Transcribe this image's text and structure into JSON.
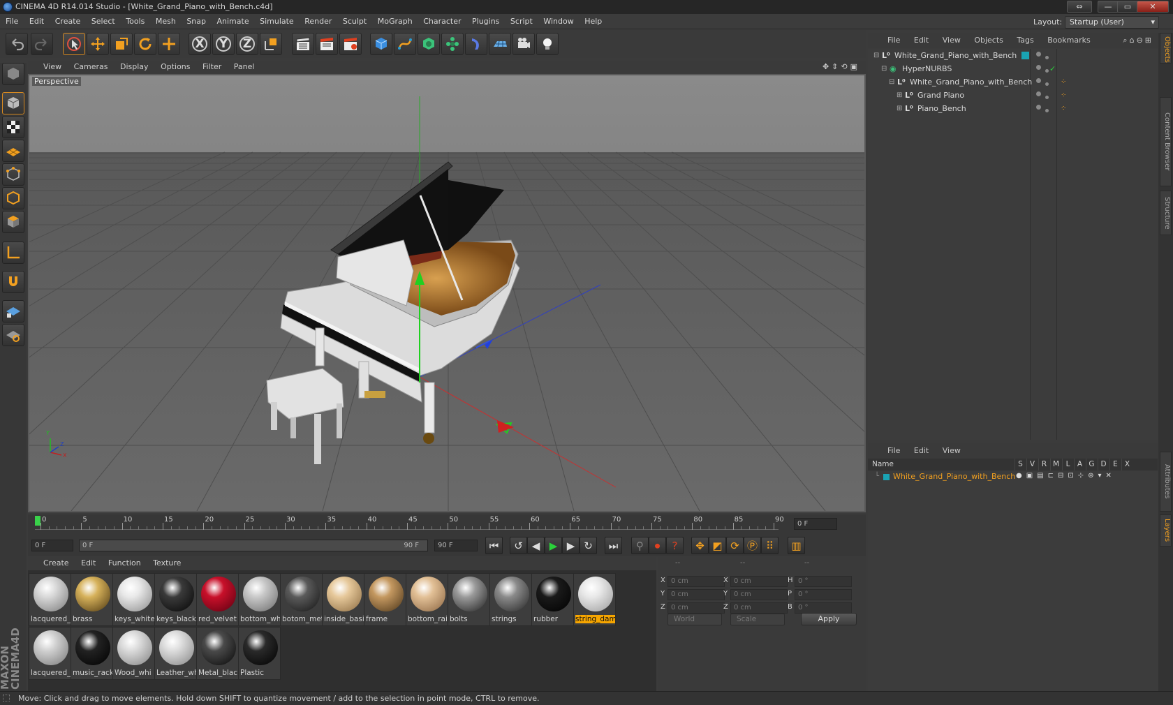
{
  "window": {
    "title": "CINEMA 4D R14.014 Studio - [White_Grand_Piano_with_Bench.c4d]",
    "btn_extra": "⇔",
    "btn_min": "—",
    "btn_max": "▭",
    "btn_close": "✕"
  },
  "menu": [
    "File",
    "Edit",
    "Create",
    "Select",
    "Tools",
    "Mesh",
    "Snap",
    "Animate",
    "Simulate",
    "Render",
    "Sculpt",
    "MoGraph",
    "Character",
    "Plugins",
    "Script",
    "Window",
    "Help"
  ],
  "layout": {
    "label": "Layout:",
    "value": "Startup (User)"
  },
  "toolbar": {
    "x": "X",
    "y": "Y",
    "z": "Z"
  },
  "viewport": {
    "menu": [
      "View",
      "Cameras",
      "Display",
      "Options",
      "Filter",
      "Panel"
    ],
    "label": "Perspective",
    "axis_y": "Y",
    "axis_z": "Z",
    "axis_x": "X"
  },
  "timeline": {
    "ticks": [
      "0",
      "5",
      "10",
      "15",
      "20",
      "25",
      "30",
      "35",
      "40",
      "45",
      "50",
      "55",
      "60",
      "65",
      "70",
      "75",
      "80",
      "85",
      "90"
    ],
    "current_frame": "0 F",
    "start": "0 F",
    "range_start": "0 F",
    "range_end": "90 F",
    "end": "90 F"
  },
  "materials": {
    "menu": [
      "Create",
      "Edit",
      "Function",
      "Texture"
    ],
    "items": [
      {
        "name": "lacquered_",
        "color": "#d8d8d8",
        "shade": "#7a7a7a"
      },
      {
        "name": "brass",
        "color": "#d6b15a",
        "shade": "#4a3510"
      },
      {
        "name": "keys_white",
        "color": "#e8e8e8",
        "shade": "#8a8a8a"
      },
      {
        "name": "keys_black",
        "color": "#3a3a3a",
        "shade": "#050505"
      },
      {
        "name": "red_velvet",
        "color": "#c8102a",
        "shade": "#5a0010"
      },
      {
        "name": "bottom_wh",
        "color": "#c8c8c8",
        "shade": "#6a6a6a"
      },
      {
        "name": "botom_met",
        "color": "#5a5a5a",
        "shade": "#151515"
      },
      {
        "name": "inside_basi",
        "color": "#e6c89a",
        "shade": "#8a6a40"
      },
      {
        "name": "frame",
        "color": "#c49860",
        "shade": "#4a3418"
      },
      {
        "name": "bottom_rai",
        "color": "#e2c096",
        "shade": "#8a6440"
      },
      {
        "name": "bolts",
        "color": "#9a9a9a",
        "shade": "#202020"
      },
      {
        "name": "strings",
        "color": "#8a8a8a",
        "shade": "#252525"
      },
      {
        "name": "rubber",
        "color": "#1a1a1a",
        "shade": "#000000"
      },
      {
        "name": "string_dam",
        "color": "#e8e8e8",
        "shade": "#9a9a9a"
      },
      {
        "name": "lacquered_",
        "color": "#d0d0d0",
        "shade": "#787878"
      },
      {
        "name": "music_rack",
        "color": "#222222",
        "shade": "#000000"
      },
      {
        "name": "Wood_whi",
        "color": "#dadada",
        "shade": "#828282"
      },
      {
        "name": "Leather_wh",
        "color": "#dcdcdc",
        "shade": "#848484"
      },
      {
        "name": "Metal_blac",
        "color": "#4a4a4a",
        "shade": "#080808"
      },
      {
        "name": "Plastic",
        "color": "#2a2a2a",
        "shade": "#000000"
      }
    ],
    "selected_index": 13
  },
  "coords": {
    "headers": [
      "--",
      "--",
      "--"
    ],
    "rows": [
      {
        "a": "X",
        "av": "0 cm",
        "b": "X",
        "bv": "0 cm",
        "c": "H",
        "cv": "0 °"
      },
      {
        "a": "Y",
        "av": "0 cm",
        "b": "Y",
        "bv": "0 cm",
        "c": "P",
        "cv": "0 °"
      },
      {
        "a": "Z",
        "av": "0 cm",
        "b": "Z",
        "bv": "0 cm",
        "c": "B",
        "cv": "0 °"
      }
    ],
    "mode": "World",
    "scale": "Scale",
    "apply": "Apply"
  },
  "objects": {
    "menu": [
      "File",
      "Edit",
      "View",
      "Objects",
      "Tags",
      "Bookmarks"
    ],
    "tree": [
      {
        "name": "White_Grand_Piano_with_Bench",
        "indent": 0
      },
      {
        "name": "HyperNURBS",
        "indent": 1
      },
      {
        "name": "White_Grand_Piano_with_Bench",
        "indent": 2
      },
      {
        "name": "Grand Piano",
        "indent": 3
      },
      {
        "name": "Piano_Bench",
        "indent": 3
      }
    ]
  },
  "layers": {
    "menu": [
      "File",
      "Edit",
      "View"
    ],
    "name_header": "Name",
    "cols": [
      "S",
      "V",
      "R",
      "M",
      "L",
      "A",
      "G",
      "D",
      "E",
      "X"
    ],
    "row": "White_Grand_Piano_with_Bench"
  },
  "right_tabs": [
    "Objects",
    "Content Browser",
    "Structure",
    "Attributes",
    "Layers"
  ],
  "brand": "MAXON CINEMA4D",
  "status": "Move: Click and drag to move elements. Hold down SHIFT to quantize movement / add to the selection in point mode, CTRL to remove."
}
